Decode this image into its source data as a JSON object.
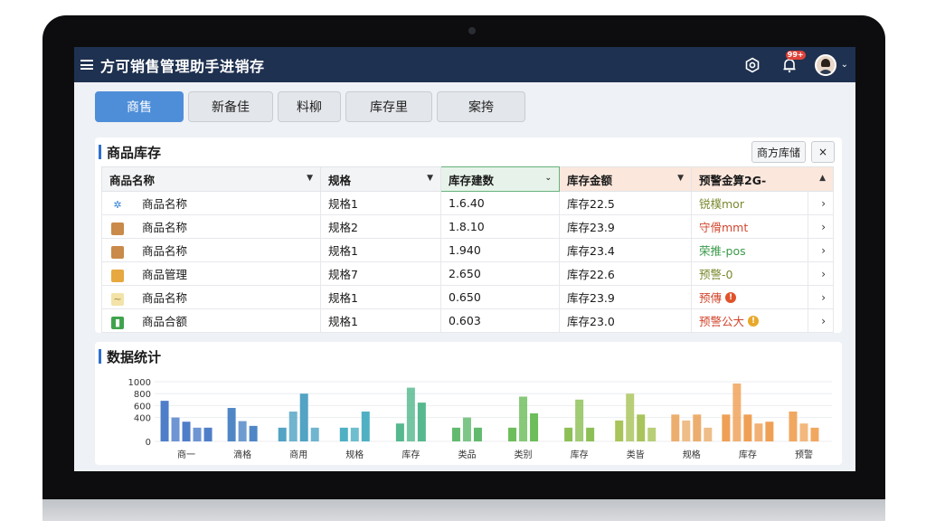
{
  "app": {
    "title": "方可销售管理助手进销存",
    "notification_badge": "99+"
  },
  "tabs": [
    {
      "label": "商售",
      "active": true
    },
    {
      "label": "新备佳",
      "active": false
    },
    {
      "label": "料柳",
      "active": false
    },
    {
      "label": "库存里",
      "active": false
    },
    {
      "label": "案挎",
      "active": false
    }
  ],
  "inventory": {
    "title": "商品库存",
    "action_label": "商方库储",
    "close_label": "×",
    "columns": [
      "商品名称",
      "规格",
      "库存建数",
      "库存金额",
      "预警金算2G-"
    ],
    "rows": [
      {
        "icon": "snowflake-icon",
        "name": "商品名称",
        "spec": "规格1",
        "qty": "1.6.40",
        "amount": "库存22.5",
        "status": "锐樸mor",
        "status_color": "#7a8a2e"
      },
      {
        "icon": "box-icon",
        "name": "商品名称",
        "spec": "规格2",
        "qty": "1.8.10",
        "amount": "库存23.9",
        "status": "守傦mmt",
        "status_color": "#d2472e"
      },
      {
        "icon": "box-icon",
        "name": "商品名称",
        "spec": "规格1",
        "qty": "1.940",
        "amount": "库存23.4",
        "status": "荣推-pos",
        "status_color": "#3a9b4a"
      },
      {
        "icon": "package-icon",
        "name": "商品管理",
        "spec": "规格7",
        "qty": "2.650",
        "amount": "库存22.6",
        "status": "预警-0",
        "status_color": "#7a8a2e"
      },
      {
        "icon": "trend-icon",
        "name": "商品名称",
        "spec": "规格1",
        "qty": "0.650",
        "amount": "库存23.9",
        "status": "预傳",
        "status_color": "#d2472e",
        "badge": "!",
        "badge_color": "#e0532a"
      },
      {
        "icon": "chart-icon",
        "name": "商品合额",
        "spec": "规格1",
        "qty": "0.603",
        "amount": "库存23.0",
        "status": "预警公大",
        "status_color": "#d2472e",
        "badge": "!",
        "badge_color": "#e8a82a"
      }
    ]
  },
  "stats": {
    "title": "数据统计"
  },
  "chart_data": {
    "type": "bar",
    "ylim": [
      0,
      1000
    ],
    "yticks": [
      "1000",
      "800",
      "600",
      "400",
      "0"
    ],
    "categories": [
      "商一",
      "滴格",
      "商用",
      "规格",
      "库存",
      "类品",
      "类别",
      "库存",
      "类皆",
      "规格",
      "库存",
      "预警"
    ],
    "group_colors": [
      "#4f7ec9",
      "#4f86c6",
      "#52a3c4",
      "#4fb0c4",
      "#56b88e",
      "#62ba6e",
      "#6dbd5a",
      "#8cc056",
      "#a8c45a",
      "#ecae6e",
      "#efa055",
      "#f0a860"
    ],
    "groups": [
      [
        680,
        400,
        330,
        230,
        230
      ],
      [
        560,
        340,
        260
      ],
      [
        230,
        500,
        800,
        230
      ],
      [
        230,
        230,
        500
      ],
      [
        300,
        900,
        650
      ],
      [
        230,
        400,
        230
      ],
      [
        230,
        750,
        470
      ],
      [
        230,
        700,
        230
      ],
      [
        350,
        800,
        450,
        230
      ],
      [
        450,
        350,
        450,
        230
      ],
      [
        450,
        970,
        450,
        300,
        330
      ],
      [
        500,
        300,
        230
      ]
    ]
  }
}
